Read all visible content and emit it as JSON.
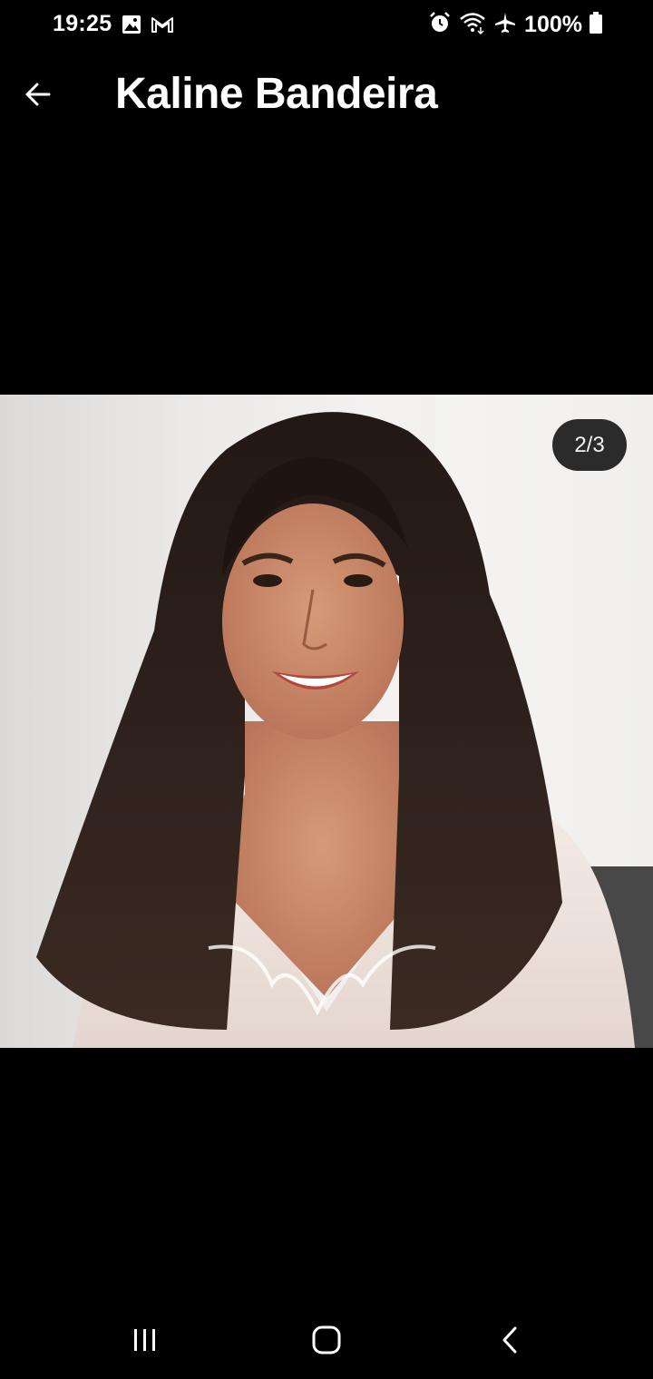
{
  "status_bar": {
    "time": "19:25",
    "battery": "100%",
    "left_icons": [
      "image-icon",
      "gmail-icon"
    ],
    "right_icons": [
      "alarm-icon",
      "wifi-icon",
      "airplane-icon",
      "battery-icon"
    ]
  },
  "app_bar": {
    "title": "Kaline Bandeira",
    "back_icon": "arrow-left-icon"
  },
  "viewer": {
    "counter": "2/3"
  },
  "nav_bar": {
    "buttons": [
      "recent-apps-icon",
      "home-icon",
      "back-icon"
    ]
  }
}
